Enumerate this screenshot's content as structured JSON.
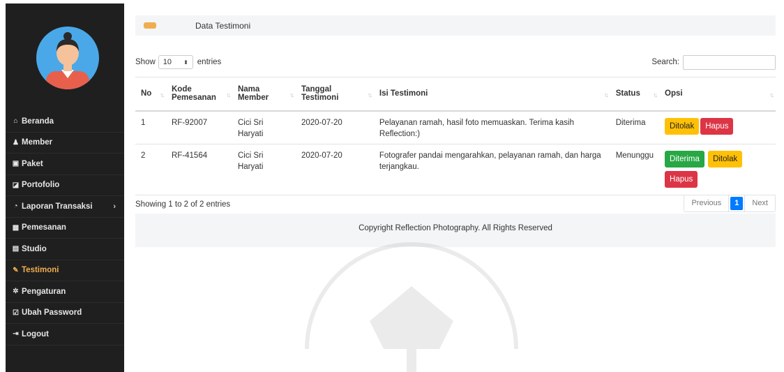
{
  "sidebar": {
    "items": [
      {
        "label": "Beranda",
        "icon": "home-icon"
      },
      {
        "label": "Member",
        "icon": "user-icon"
      },
      {
        "label": "Paket",
        "icon": "image-icon"
      },
      {
        "label": "Portofolio",
        "icon": "book-icon"
      },
      {
        "label": "Laporan Transaksi",
        "icon": "receipt-icon"
      },
      {
        "label": "Pemesanan",
        "icon": "calendar-icon"
      },
      {
        "label": "Studio",
        "icon": "camera-icon"
      },
      {
        "label": "Testimoni",
        "icon": "pencil-icon"
      },
      {
        "label": "Pengaturan",
        "icon": "gear-icon"
      },
      {
        "label": "Ubah Password",
        "icon": "edit-icon"
      },
      {
        "label": "Logout",
        "icon": "logout-icon"
      }
    ],
    "active_item": "Testimoni"
  },
  "header": {
    "title": "Data Testimoni"
  },
  "controls": {
    "show_label": "Show",
    "entries_label": "entries",
    "page_length": "10",
    "search_label": "Search:",
    "search_value": ""
  },
  "table": {
    "columns": {
      "no": "No",
      "kode": "Kode Pemesanan",
      "nama": "Nama Member",
      "tanggal": "Tanggal Testimoni",
      "isi": "Isi Testimoni",
      "status": "Status",
      "opsi": "Opsi"
    },
    "rows": [
      {
        "no": "1",
        "kode": "RF-92007",
        "nama": "Cici Sri Haryati",
        "tanggal": "2020-07-20",
        "isi": "Pelayanan ramah, hasil foto memuaskan. Terima kasih Reflection:)",
        "status": "Diterima",
        "btn1": "Ditolak",
        "btn2": "Hapus"
      },
      {
        "no": "2",
        "kode": "RF-41564",
        "nama": "Cici Sri Haryati",
        "tanggal": "2020-07-20",
        "isi": "Fotografer pandai mengarahkan, pelayanan ramah, dan harga terjangkau.",
        "status": "Menunggu",
        "btn1": "Diterima",
        "btn2": "Ditolak",
        "btn3": "Hapus"
      }
    ]
  },
  "pagination": {
    "info": "Showing 1 to 2 of 2 entries",
    "previous": "Previous",
    "current": "1",
    "next": "Next"
  },
  "footer": {
    "text": "Copyright Reflection Photography. All Rights Reserved"
  },
  "colors": {
    "sidebar_bg": "#1f1f1f",
    "accent": "#f0ad4e",
    "warning": "#ffc107",
    "danger": "#dc3545",
    "success": "#28a745",
    "primary": "#007bff"
  }
}
